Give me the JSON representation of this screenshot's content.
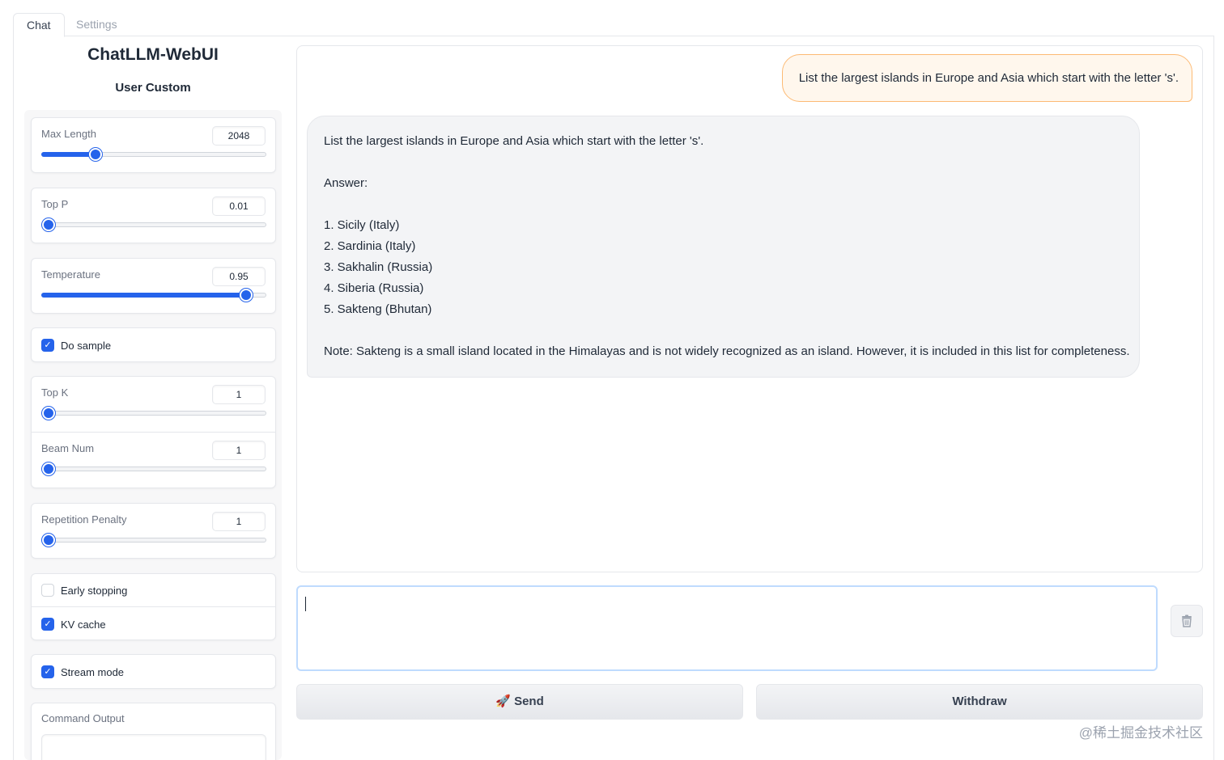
{
  "tabs": [
    {
      "label": "Chat",
      "active": true
    },
    {
      "label": "Settings",
      "active": false
    }
  ],
  "app_title": "ChatLLM-WebUI",
  "section_title": "User Custom",
  "params": {
    "max_length": {
      "label": "Max Length",
      "value": "2048",
      "fraction": 0.22
    },
    "top_p": {
      "label": "Top P",
      "value": "0.01",
      "fraction": 0.0
    },
    "temperature": {
      "label": "Temperature",
      "value": "0.95",
      "fraction": 0.93
    },
    "top_k": {
      "label": "Top K",
      "value": "1",
      "fraction": 0.0
    },
    "beam_num": {
      "label": "Beam Num",
      "value": "1",
      "fraction": 0.0
    },
    "repetition_penalty": {
      "label": "Repetition Penalty",
      "value": "1",
      "fraction": 0.0
    }
  },
  "checks": {
    "do_sample": {
      "label": "Do sample",
      "checked": true
    },
    "early_stopping": {
      "label": "Early stopping",
      "checked": false
    },
    "kv_cache": {
      "label": "KV cache",
      "checked": true
    },
    "stream_mode": {
      "label": "Stream mode",
      "checked": true
    }
  },
  "command_output": {
    "label": "Command Output",
    "value": ""
  },
  "chat": {
    "user_message": "List the largest islands in Europe and Asia which start with the letter 's'.",
    "bot_lines": [
      "List the largest islands in Europe and Asia which start with the letter 's'.",
      "",
      "Answer:",
      "",
      "1. Sicily (Italy)",
      "2. Sardinia (Italy)",
      "3. Sakhalin (Russia)",
      "4. Siberia (Russia)",
      "5. Sakteng (Bhutan)",
      "",
      "Note: Sakteng is a small island located in the Himalayas and is not widely recognized as an island. However, it is included in this list for completeness."
    ]
  },
  "input": {
    "value": "",
    "placeholder": ""
  },
  "buttons": {
    "send_icon": "🚀",
    "send": "Send",
    "withdraw": "Withdraw",
    "clear_icon": "trash-icon"
  },
  "watermark": "@稀土掘金技术社区",
  "colors": {
    "accent": "#2563eb",
    "user_bubble_bg": "#fff7ed",
    "user_bubble_border": "#fdba74",
    "bot_bubble_bg": "#f3f4f6"
  }
}
